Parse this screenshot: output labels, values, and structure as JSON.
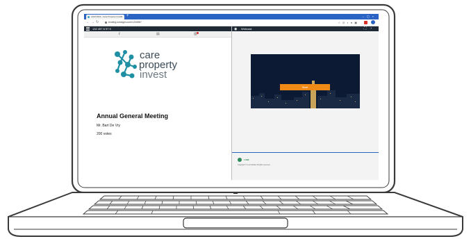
{
  "browser": {
    "tab_title": "AGM 2019 - Care Property Invest",
    "url": "evoting.lumiagm.com/1234567"
  },
  "left_panel": {
    "header_text": "132 457 6 97 5",
    "icons": [
      "info-icon",
      "documents-icon",
      "vote-icon"
    ],
    "logo": {
      "line1": "care",
      "line2": "property",
      "line3": "invest",
      "mark_color": "#1f8fa3"
    },
    "meeting_title": "Annual General Meeting",
    "holder_name": "Mr. Bart De Vry",
    "votes_text": "200 votes"
  },
  "right_panel": {
    "header_title": "Webcast",
    "start_button": "Start",
    "footer_brand": "LUMI",
    "footer_copy": "Copyright © Lumi Global. All rights reserved.",
    "accent_color": "#f08a17"
  }
}
